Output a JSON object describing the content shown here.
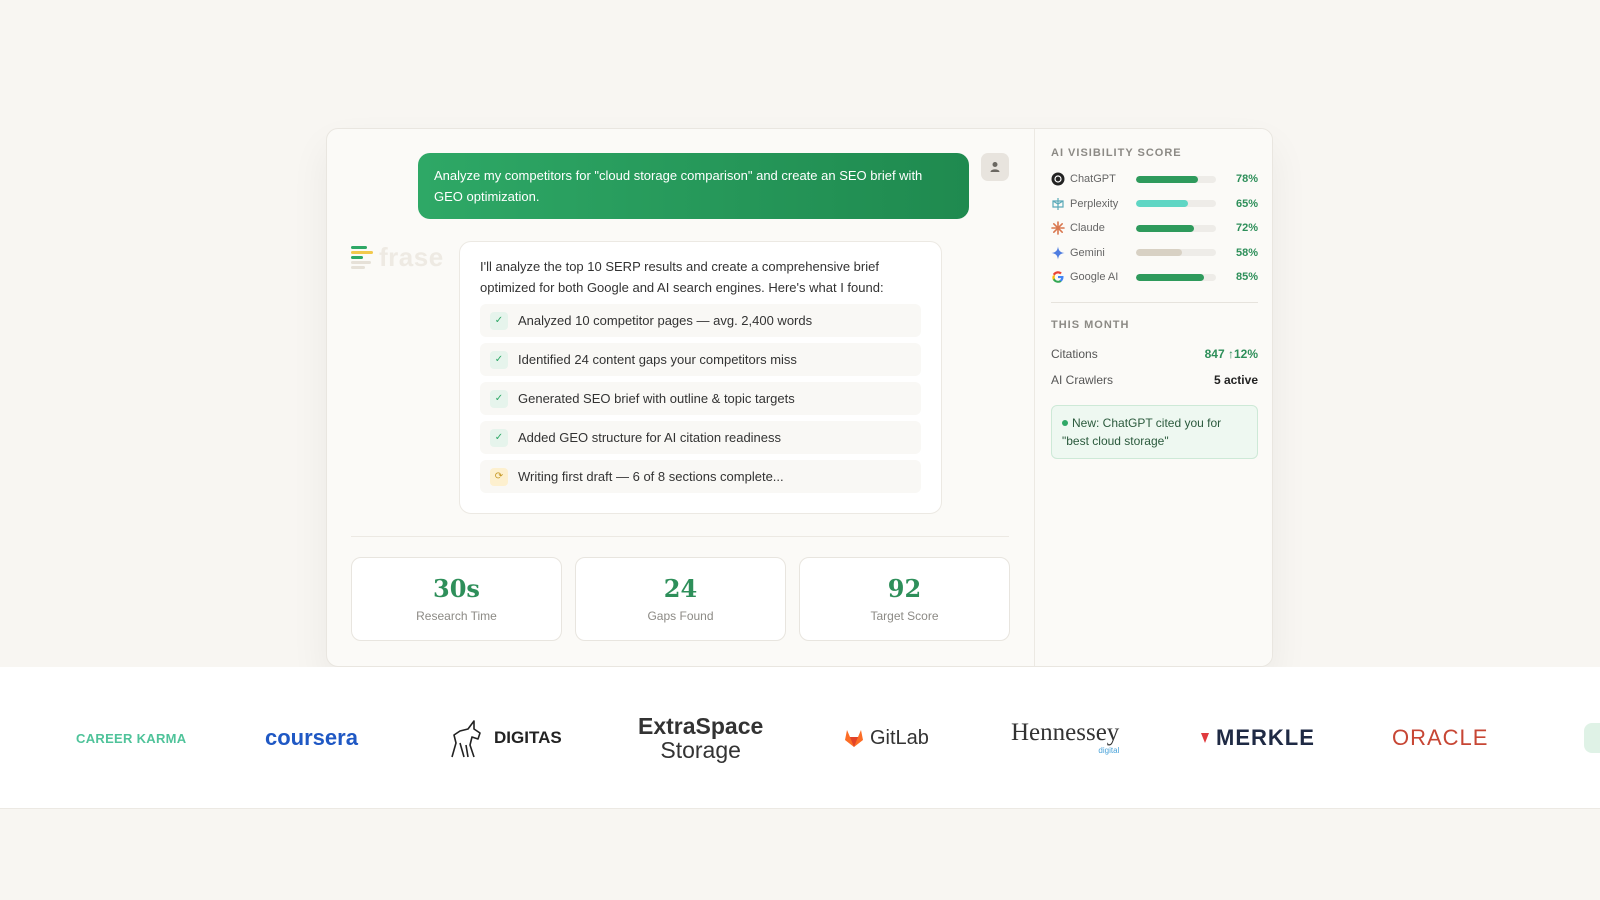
{
  "user_message": "Analyze my competitors for \"cloud storage comparison\" and create an SEO brief with GEO optimization.",
  "brand": {
    "name": "frase",
    "accent": "#2ea866"
  },
  "bot": {
    "intro": "I'll analyze the top 10 SERP results and create a comprehensive brief optimized for both Google and AI search engines. Here's what I found:",
    "tasks": [
      {
        "text": "Analyzed 10 competitor pages — avg. 2,400 words",
        "status": "done"
      },
      {
        "text": "Identified 24 content gaps your competitors miss",
        "status": "done"
      },
      {
        "text": "Generated SEO brief with outline & topic targets",
        "status": "done"
      },
      {
        "text": "Added GEO structure for AI citation readiness",
        "status": "done"
      },
      {
        "text": "Writing first draft — 6 of 8 sections complete...",
        "status": "in-progress"
      }
    ]
  },
  "stats": [
    {
      "value": "30s",
      "label": "Research Time"
    },
    {
      "value": "24",
      "label": "Gaps Found"
    },
    {
      "value": "92",
      "label": "Target Score"
    }
  ],
  "sidebar": {
    "visibility_title": "AI VISIBILITY SCORE",
    "engines": [
      {
        "name": "ChatGPT",
        "pct": "78%",
        "value": 78,
        "color": "#2e9a5c",
        "icon": "chatgpt-icon"
      },
      {
        "name": "Perplexity",
        "pct": "65%",
        "value": 65,
        "color": "#5fd6c4",
        "icon": "perplexity-icon"
      },
      {
        "name": "Claude",
        "pct": "72%",
        "value": 72,
        "color": "#2e9a5c",
        "icon": "claude-icon"
      },
      {
        "name": "Gemini",
        "pct": "58%",
        "value": 58,
        "color": "#d8d1c4",
        "icon": "gemini-icon"
      },
      {
        "name": "Google AI",
        "pct": "85%",
        "value": 85,
        "color": "#2e9a5c",
        "icon": "google-icon"
      }
    ],
    "month_title": "THIS MONTH",
    "citations_label": "Citations",
    "citations_value": "847 ↑12%",
    "crawlers_label": "AI Crawlers",
    "crawlers_value": "5 active",
    "notice": "New: ChatGPT cited you for \"best cloud storage\""
  },
  "logos": [
    {
      "text": "CAREER KARMA"
    },
    {
      "text": "coursera"
    },
    {
      "text": "DIGITAS"
    },
    {
      "text": "ExtraSpace",
      "text2": "Storage"
    },
    {
      "text": "GitLab"
    },
    {
      "text": "Hennessey",
      "text2": "digital"
    },
    {
      "text": "MERKLE"
    },
    {
      "text": "ORACLE"
    }
  ]
}
